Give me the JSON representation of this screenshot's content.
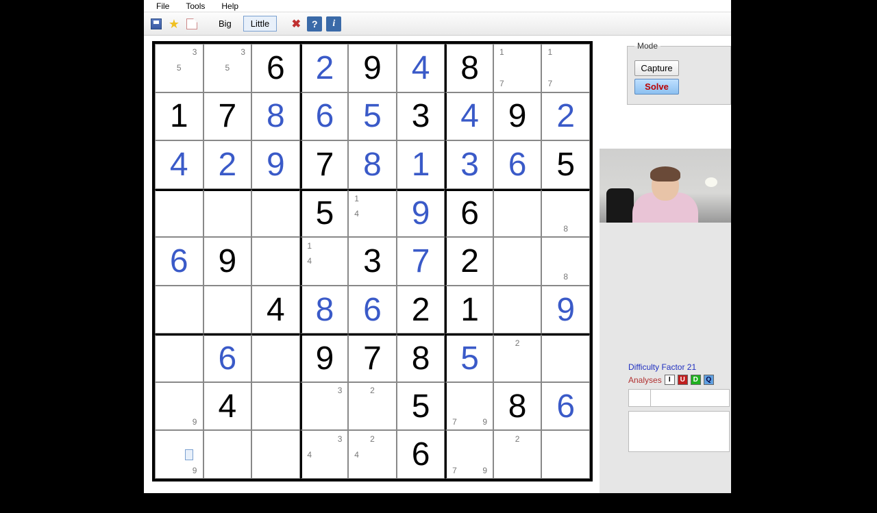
{
  "menu": {
    "file": "File",
    "tools": "Tools",
    "help": "Help"
  },
  "toolbar": {
    "big": "Big",
    "little": "Little",
    "help_symbol": "?",
    "info_symbol": "i"
  },
  "mode": {
    "title": "Mode",
    "capture": "Capture",
    "solve": "Solve"
  },
  "status": {
    "difficulty": "Difficulty Factor 21",
    "analyses_label": "Analyses",
    "analyses": [
      "I",
      "U",
      "D",
      "Q"
    ]
  },
  "chart_data": {
    "type": "table",
    "title": "Sudoku 9x9",
    "grid": [
      [
        {
          "pencil": [
            "3",
            "5"
          ]
        },
        {
          "pencil": [
            "3",
            "5"
          ]
        },
        {
          "big": "6",
          "given": true
        },
        {
          "big": "2",
          "given": false
        },
        {
          "big": "9",
          "given": true
        },
        {
          "big": "4",
          "given": false
        },
        {
          "big": "8",
          "given": true
        },
        {
          "pencil": [
            "1",
            "7"
          ]
        },
        {
          "pencil": [
            "1",
            "7"
          ]
        }
      ],
      [
        {
          "big": "1",
          "given": true
        },
        {
          "big": "7",
          "given": true
        },
        {
          "big": "8",
          "given": false
        },
        {
          "big": "6",
          "given": false
        },
        {
          "big": "5",
          "given": false
        },
        {
          "big": "3",
          "given": true
        },
        {
          "big": "4",
          "given": false
        },
        {
          "big": "9",
          "given": true
        },
        {
          "big": "2",
          "given": false
        }
      ],
      [
        {
          "big": "4",
          "given": false
        },
        {
          "big": "2",
          "given": false
        },
        {
          "big": "9",
          "given": false
        },
        {
          "big": "7",
          "given": true
        },
        {
          "big": "8",
          "given": false
        },
        {
          "big": "1",
          "given": false
        },
        {
          "big": "3",
          "given": false
        },
        {
          "big": "6",
          "given": false
        },
        {
          "big": "5",
          "given": true
        }
      ],
      [
        {},
        {},
        {},
        {
          "big": "5",
          "given": true
        },
        {
          "pencil": [
            "1",
            "4"
          ]
        },
        {
          "big": "9",
          "given": false
        },
        {
          "big": "6",
          "given": true
        },
        {},
        {
          "pencil": [
            "8"
          ]
        }
      ],
      [
        {
          "big": "6",
          "given": false
        },
        {
          "big": "9",
          "given": true
        },
        {},
        {
          "pencil": [
            "1",
            "4"
          ]
        },
        {
          "big": "3",
          "given": true
        },
        {
          "big": "7",
          "given": false
        },
        {
          "big": "2",
          "given": true
        },
        {},
        {
          "pencil": [
            "8"
          ]
        }
      ],
      [
        {},
        {},
        {
          "big": "4",
          "given": true
        },
        {
          "big": "8",
          "given": false
        },
        {
          "big": "6",
          "given": false
        },
        {
          "big": "2",
          "given": true
        },
        {
          "big": "1",
          "given": true
        },
        {},
        {
          "big": "9",
          "given": false
        }
      ],
      [
        {},
        {
          "big": "6",
          "given": false
        },
        {},
        {
          "big": "9",
          "given": true
        },
        {
          "big": "7",
          "given": true
        },
        {
          "big": "8",
          "given": true
        },
        {
          "big": "5",
          "given": false
        },
        {
          "pencil": [
            "2"
          ]
        },
        {}
      ],
      [
        {
          "pencil": [
            "9"
          ]
        },
        {
          "big": "4",
          "given": true
        },
        {},
        {
          "pencil": [
            "3"
          ]
        },
        {
          "pencil": [
            "2"
          ]
        },
        {
          "big": "5",
          "given": true
        },
        {
          "pencil": [
            "7",
            "9"
          ]
        },
        {
          "big": "8",
          "given": true
        },
        {
          "big": "6",
          "given": false
        }
      ],
      [
        {
          "pencil": [
            "9"
          ]
        },
        {},
        {},
        {
          "pencil": [
            "3",
            "4"
          ]
        },
        {
          "pencil": [
            "2",
            "4"
          ]
        },
        {
          "big": "6",
          "given": true
        },
        {
          "pencil": [
            "7",
            "9"
          ]
        },
        {
          "pencil": [
            "2"
          ]
        },
        {}
      ]
    ]
  }
}
